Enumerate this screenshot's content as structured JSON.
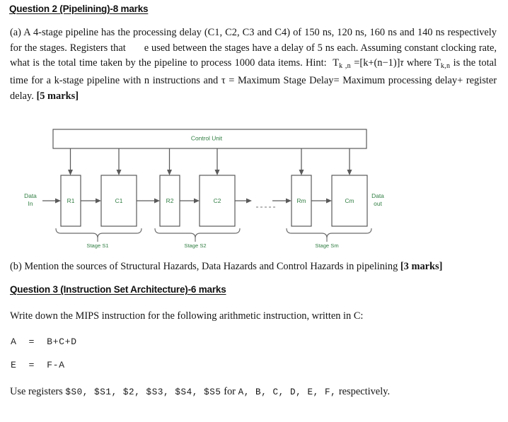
{
  "document": {
    "type": "exam-question-sheet",
    "background_color": "#ffffff",
    "diagram_text_color": "#2f7d41"
  },
  "q2": {
    "heading": "Question 2 (Pipelining)-8 marks",
    "part_a": {
      "seg1": "(a) A 4-stage pipeline has the processing delay (C1, C2, C3 and C4) of 150 ns, 120 ns, 160 ns and 140 ns respectively for the stages. Registers that",
      "seg2": "e used between the stages have a delay of 5 ns each. Assuming constant clocking rate, what is the total time taken by the pipeline to process 1000 data items. Hint:",
      "formula_lhs_base": "T",
      "formula_lhs_sub": "k ,n",
      "formula_mid": " =[k+(n−1)]",
      "formula_tau": "τ",
      "formula_after": " where T",
      "formula_sub2": "k,n",
      "seg3": " is the total time for a k-stage pipeline with n instructions and  τ = Maximum Stage Delay= Maximum processing delay+ register delay.",
      "marks": "[5 marks]"
    },
    "part_b": {
      "text": "(b) Mention the sources of Structural Hazards, Data Hazards and Control Hazards in pipelining ",
      "marks": "[3 marks]"
    }
  },
  "q3": {
    "heading": "Question 3 (Instruction Set Architecture)-6 marks",
    "intro": "Write down the MIPS instruction for the following arithmetic instruction, written in C:",
    "code_lines": [
      "A  =  B+C+D",
      "E  =  F-A"
    ],
    "registers_line": {
      "prefix": "Use registers ",
      "registers": "$S0,  $S1,  $2,  $S3,  $S4,  $S5",
      "middle": " for ",
      "variables": "A,  B,  C,  D,  E,  F,",
      "suffix": " respectively."
    }
  },
  "diagram": {
    "name": "pipeline-block-diagram",
    "control_unit_label": "Control Unit",
    "data_in_line1": "Data",
    "data_in_line2": "In",
    "data_out_line1": "Data",
    "data_out_line2": "out",
    "ellipsis": "- - - - -",
    "blocks": [
      {
        "label": "R1",
        "kind": "register"
      },
      {
        "label": "C1",
        "kind": "combinational"
      },
      {
        "label": "R2",
        "kind": "register"
      },
      {
        "label": "C2",
        "kind": "combinational"
      },
      {
        "label": "Rm",
        "kind": "register"
      },
      {
        "label": "Cm",
        "kind": "combinational"
      }
    ],
    "stages": [
      {
        "label": "Stage S1"
      },
      {
        "label": "Stage S2"
      },
      {
        "label": "Stage Sm"
      }
    ]
  }
}
